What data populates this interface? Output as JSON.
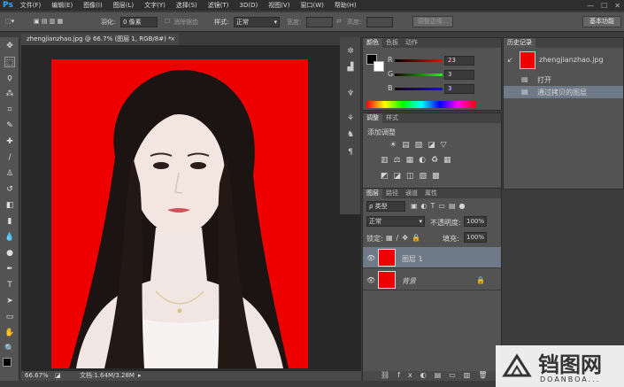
{
  "app": {
    "logo": "Ps"
  },
  "menubar": {
    "items": [
      "文件(F)",
      "编辑(E)",
      "图像(I)",
      "图层(L)",
      "文字(Y)",
      "选择(S)",
      "滤镜(T)",
      "3D(D)",
      "视图(V)",
      "窗口(W)",
      "帮助(H)"
    ]
  },
  "optbar": {
    "feather_label": "羽化:",
    "feather_value": "0 像素",
    "antialias_label": "消除锯齿",
    "style_label": "样式:",
    "style_value": "正常",
    "width_label": "宽度:",
    "height_label": "高度:",
    "refine_label": "调整边缘...",
    "workspace": "基本功能"
  },
  "document": {
    "tab_label": "zhengjianzhao.jpg @ 66.7% (图层 1, RGB/8#) *",
    "zoom": "66.67%",
    "doc_info": "文档:1.64M/3.28M"
  },
  "color_panel": {
    "tabs": [
      "颜色",
      "色板",
      "动作"
    ],
    "r_value": "23",
    "g_value": "3",
    "b_value": "3"
  },
  "adjust_panel": {
    "tabs": [
      "调整",
      "样式"
    ],
    "title": "添加调整"
  },
  "history_panel": {
    "tab": "历史记录",
    "snapshot": "zhengjianzhao.jpg",
    "items": [
      "打开",
      "通过拷贝的图层"
    ]
  },
  "layers_panel": {
    "tabs": [
      "图层",
      "路径",
      "通道",
      "属性"
    ],
    "kind_label": "类型",
    "blend_mode": "正常",
    "opacity_label": "不透明度:",
    "opacity_value": "100%",
    "lock_label": "锁定:",
    "fill_label": "填充:",
    "fill_value": "100%",
    "layers": [
      "图层 1",
      "背景"
    ]
  },
  "watermark": {
    "title": "铛图网",
    "sub": "DOANBOA..."
  },
  "colors": {
    "accent": "#31a8ff",
    "photo_bg": "#ee0000"
  }
}
